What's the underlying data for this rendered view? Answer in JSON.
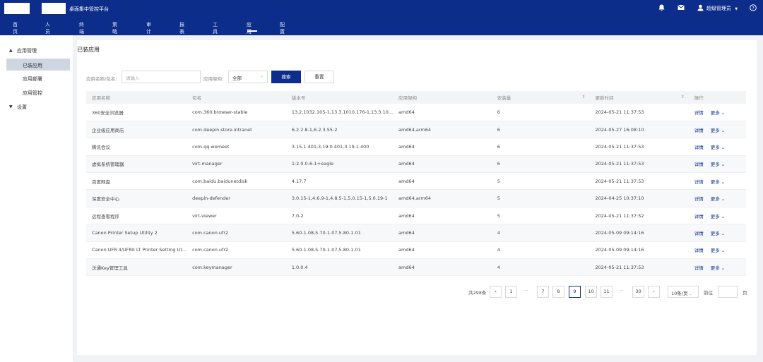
{
  "header": {
    "app_title": "桌面集中管控平台",
    "user_label": "超级管理员",
    "nav": [
      "首页",
      "人员",
      "终端",
      "策略",
      "审计",
      "报表",
      "工具",
      "应用",
      "配置"
    ],
    "active_nav": "应用",
    "icons": [
      "bell-icon",
      "mail-icon",
      "user-icon",
      "help-icon"
    ]
  },
  "sidebar": {
    "groups": [
      {
        "label": "应用管理",
        "expanded": true,
        "items": [
          "已装应用",
          "应用部署",
          "应用管控"
        ]
      },
      {
        "label": "设置",
        "expanded": false,
        "items": []
      }
    ],
    "active_item": "已装应用"
  },
  "page": {
    "title": "已装应用",
    "filter": {
      "name_label": "应用名称/包名:",
      "name_placeholder": "请输入",
      "arch_label": "应用架构:",
      "arch_value": "全部",
      "search_button": "搜索",
      "reset_button": "重置"
    },
    "table": {
      "columns": [
        "应用名称",
        "包名",
        "版本号",
        "应用架构",
        "安装量",
        "更新时间",
        "操作"
      ],
      "rows": [
        [
          "360安全浏览器",
          "com.360.browser-stable",
          "13.2.1032.105-1,13.3.1010.176-1,13.3.10...",
          "amd64",
          "6",
          "2024-05-21 11:37:53"
        ],
        [
          "企业级应用商店",
          "com.deepin.store.intranet",
          "6.2.2.8-1,6.2.3.55-2",
          "amd64,arm64",
          "6",
          "2024-05-27 16:08:10"
        ],
        [
          "腾讯会议",
          "com.qq.wemeet",
          "3.15.1.401,3.19.0.401,3.19.1.400",
          "amd64",
          "6",
          "2024-05-21 11:37:53"
        ],
        [
          "虚拟系统管理器",
          "virt-manager",
          "1:2.0.0-6-1+eagle",
          "amd64",
          "6",
          "2024-05-21 11:37:53"
        ],
        [
          "百度网盘",
          "com.baidu.baidunetdisk",
          "4.17.7",
          "amd64",
          "5",
          "2024-05-21 11:37:53"
        ],
        [
          "深度安全中心",
          "deepin-defender",
          "3.0.15-1,4.6.9-1,4.8.5-1,5.0.15-1,5.0.19-1",
          "amd64,arm64",
          "5",
          "2024-04-25 10:37:10"
        ],
        [
          "远程查看程序",
          "virt-viewer",
          "7.0-2",
          "amd64",
          "5",
          "2024-05-21 11:37:52"
        ],
        [
          "Canon Printer Setup Utility 2",
          "com.canon.ufr2",
          "5.60-1.08,5.70-1.07,5.80-1.01",
          "amd64",
          "4",
          "2024-05-09 09:14:16"
        ],
        [
          "Canon UFR II/UFRII LT Printer Setting Ut...",
          "com.canon.ufr2",
          "5.60-1.08,5.70-1.07,5.80-1.01",
          "amd64",
          "4",
          "2024-05-09 09:14:16"
        ],
        [
          "沃通Key管理工具",
          "com.keymanager",
          "1.0.0.4",
          "amd64",
          "4",
          "2024-05-21 11:37:53"
        ]
      ],
      "action_detail": "详情",
      "action_more": "更多"
    },
    "pagination": {
      "total": "共298条",
      "pages": [
        "1",
        "7",
        "8",
        "9",
        "10",
        "11",
        "30"
      ],
      "current": "9",
      "page_size": "10条/页",
      "goto_label": "前往",
      "goto_suffix": "页"
    }
  }
}
